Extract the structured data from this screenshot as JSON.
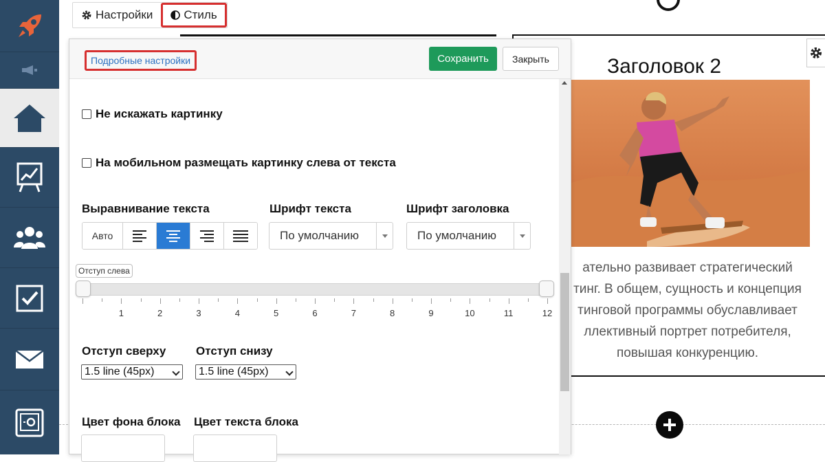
{
  "sidebar": {
    "items": [
      {
        "name": "rocket-icon"
      },
      {
        "name": "megaphone-icon"
      },
      {
        "name": "home-icon",
        "active": true
      },
      {
        "name": "chart-board-icon"
      },
      {
        "name": "users-icon"
      },
      {
        "name": "checkbox-icon"
      },
      {
        "name": "mail-icon"
      },
      {
        "name": "safe-icon"
      }
    ],
    "colors": {
      "background": "#2c4a66",
      "active": "#ebebeb",
      "rocket": "#e8643a"
    }
  },
  "top_tabs": {
    "settings_label": "Настройки",
    "settings_icon": "gear-icon",
    "style_label": "Стиль",
    "style_icon": "contrast-icon"
  },
  "panel": {
    "detailed_settings_link": "Подробные настройки",
    "save_label": "Сохранить",
    "close_label": "Закрыть",
    "save_color": "#1e9a5a",
    "checkbox_keep_image": "Не искажать картинку",
    "checkbox_mobile_left": "На мобильном размещать картинку слева от текста",
    "text_align_label": "Выравнивание текста",
    "text_align": {
      "auto_label": "Авто",
      "options": [
        "align-left-icon",
        "align-center-icon",
        "align-right-icon",
        "align-justify-icon"
      ],
      "selected": "align-center-icon",
      "selected_color": "#2a7bd4"
    },
    "text_font_label": "Шрифт текста",
    "text_font_value": "По умолчанию",
    "heading_font_label": "Шрифт заголовка",
    "heading_font_value": "По умолчанию",
    "left_indent_label": "Отступ слева",
    "left_indent_ticks": [
      "1",
      "2",
      "3",
      "4",
      "5",
      "6",
      "7",
      "8",
      "9",
      "10",
      "11",
      "12"
    ],
    "left_indent_value": 0,
    "top_indent_label": "Отступ сверху",
    "top_indent_value": "1.5 line (45px)",
    "bottom_indent_label": "Отступ снизу",
    "bottom_indent_value": "1.5 line (45px)",
    "bg_color_label": "Цвет фона блока",
    "text_color_label": "Цвет текста блока"
  },
  "card": {
    "title": "Заголовок 2",
    "image": "sandboarding-woman-photo",
    "text_lines": [
      "ательно развивает стратегический",
      "тинг. В общем, сущность и концепция",
      "тинговой программы обуславливает",
      "ллективный портрет потребителя,",
      "повышая конкуренцию."
    ]
  },
  "add_block_icon": "plus-icon",
  "highlight_color": "#d62f2f"
}
